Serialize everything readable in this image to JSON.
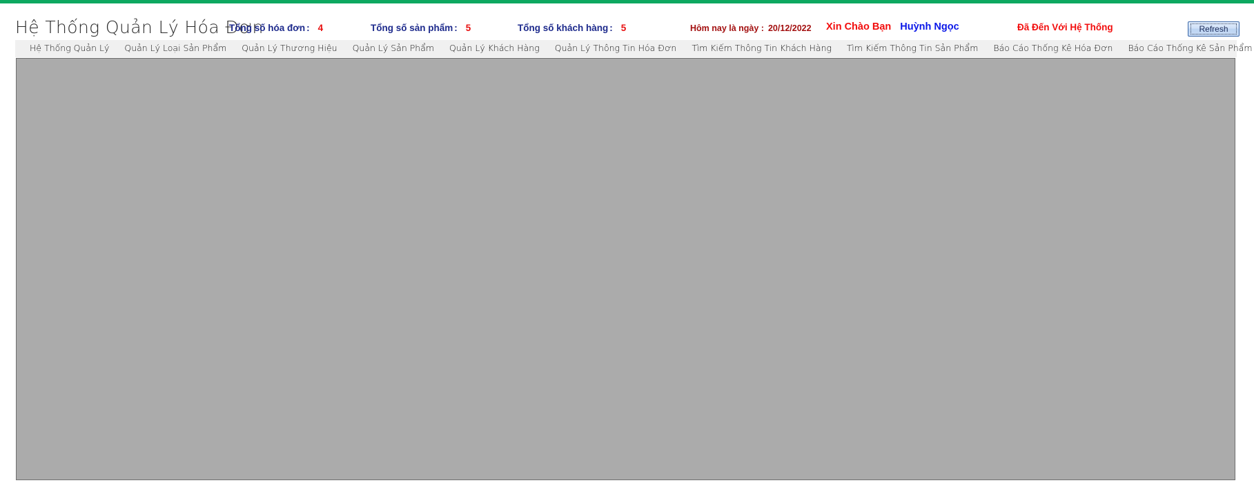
{
  "window": {
    "accent_color": "#0da860",
    "controls": {
      "minimize_glyph": "−",
      "close_glyph": "✕"
    }
  },
  "header": {
    "app_title": "Hệ Thống Quản Lý Hóa Đơn",
    "stats": [
      {
        "label": "Tổng số hóa đơn",
        "colon": ":",
        "value": "4"
      },
      {
        "label": "Tổng số sản phẩm",
        "colon": ":",
        "value": "5"
      },
      {
        "label": "Tổng số khách hàng",
        "colon": ":",
        "value": "5"
      }
    ],
    "date": {
      "label": "Hôm nay là ngày :",
      "value": "20/12/2022",
      "color": "#a31010"
    },
    "greeting": {
      "text": "Xin Chào Bạn",
      "text_color": "#f20d0d",
      "user_name": "Huỳnh Ngọc",
      "user_name_color": "#0a17e8"
    },
    "welcome": {
      "text": "Đã Đến Với Hệ Thống",
      "color": "#f20d0d"
    },
    "refresh_label": "Refresh"
  },
  "menu": {
    "items": [
      {
        "label": "Hệ Thống Quản Lý"
      },
      {
        "label": "Quản Lý Loại Sản Phẩm"
      },
      {
        "label": "Quản Lý Thương Hiệu"
      },
      {
        "label": "Quản Lý Sản Phẩm"
      },
      {
        "label": "Quản Lý Khách Hàng"
      },
      {
        "label": "Quản Lý Thông Tin Hóa Đơn"
      },
      {
        "label": "Tìm Kiếm Thông Tin Khách Hàng"
      },
      {
        "label": "Tìm Kiếm Thông Tin Sản Phẩm"
      },
      {
        "label": "Báo Cáo Thống Kê Hóa Đơn"
      },
      {
        "label": "Báo Cáo Thống Kê Sản Phẩm"
      }
    ]
  },
  "content": {
    "background_color": "#ababab",
    "body_text": ""
  }
}
